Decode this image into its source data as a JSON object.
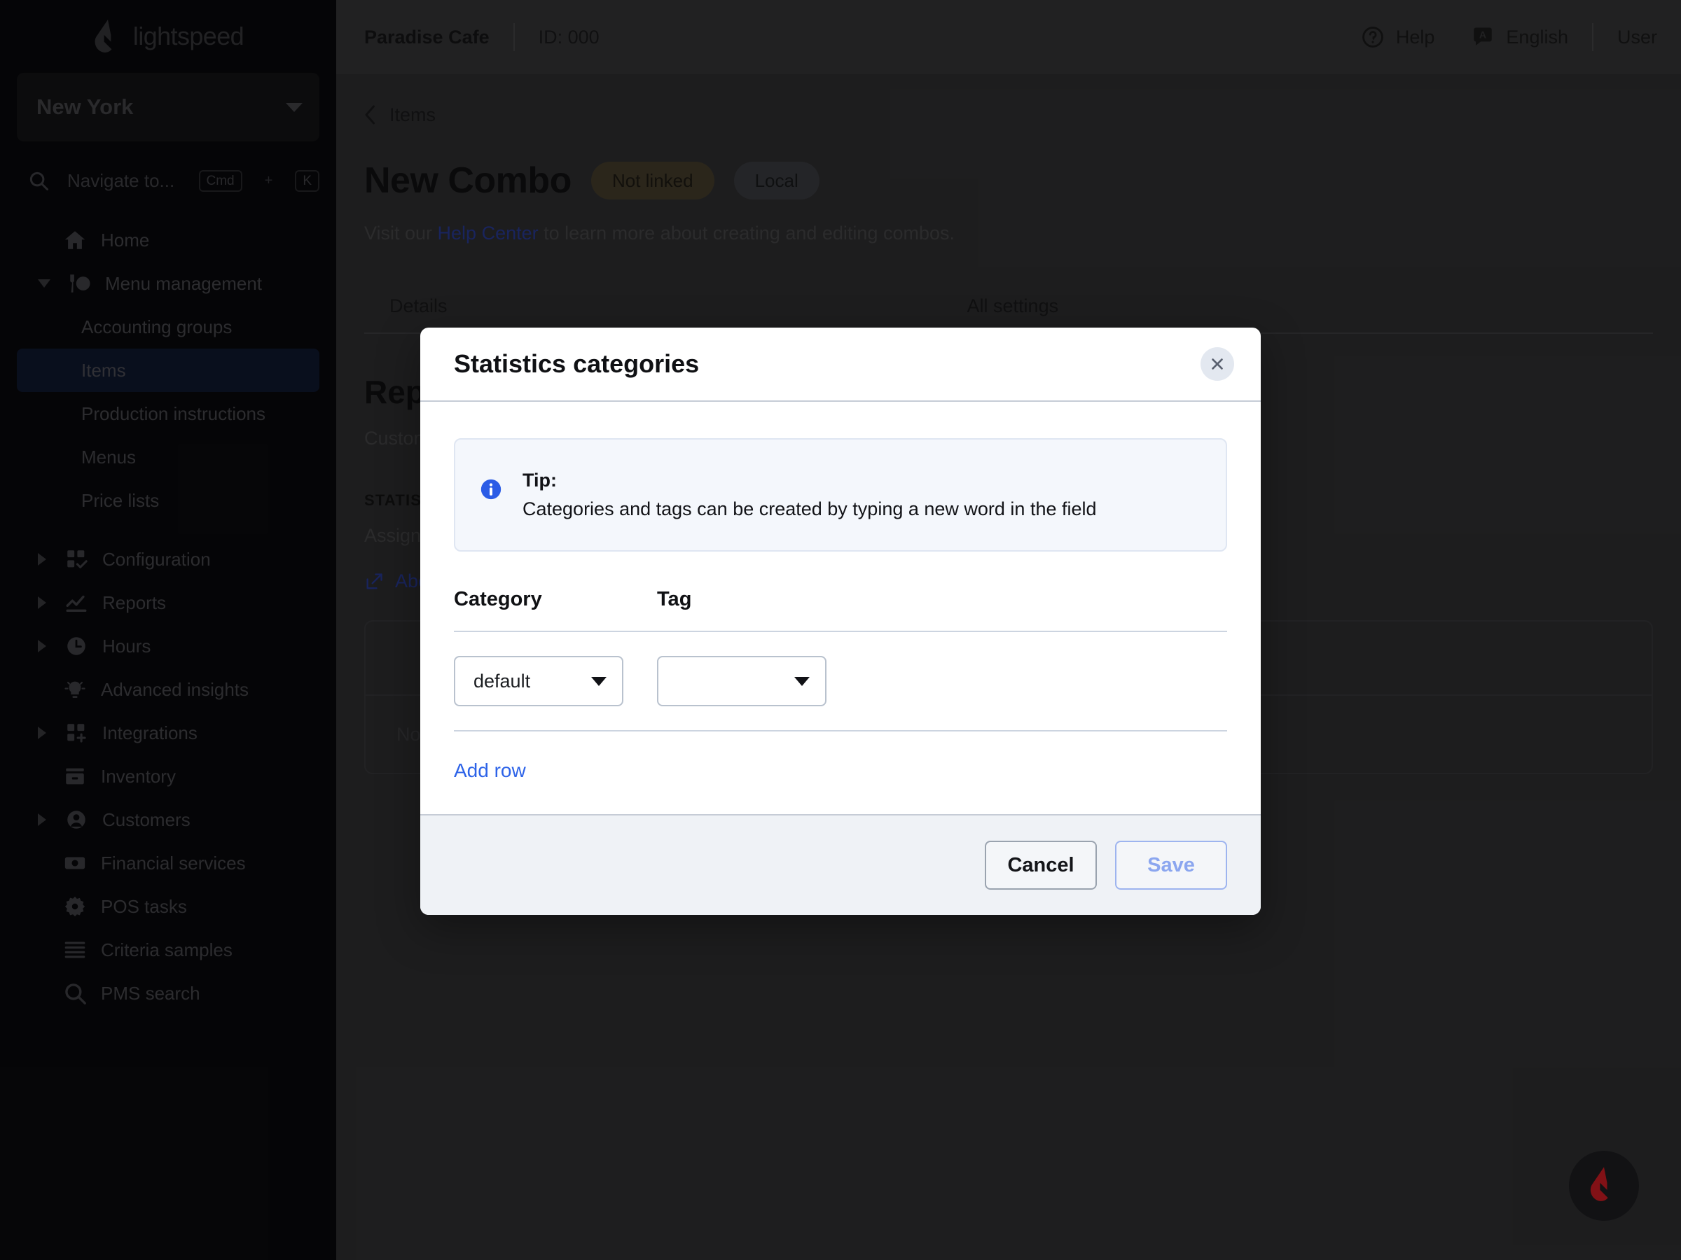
{
  "sidebar": {
    "brand": {
      "name": "lightspeed",
      "logo_icon": "lightspeed-flame-icon"
    },
    "location": {
      "value": "New York",
      "caret_icon": "chevron-down-icon"
    },
    "search": {
      "placeholder": "Navigate to...",
      "icon": "search-icon",
      "shortcut_key": "Cmd",
      "shortcut_plus": "+",
      "shortcut_key2": "K"
    },
    "items": [
      {
        "label": "Home",
        "icon": "home-icon",
        "expandable": false
      },
      {
        "label": "Menu management",
        "icon": "menu-management-icon",
        "expandable": true,
        "expanded": true
      }
    ],
    "menu_children": [
      {
        "label": "Accounting groups",
        "active": false
      },
      {
        "label": "Items",
        "active": true
      },
      {
        "label": "Production instructions",
        "active": false
      },
      {
        "label": "Menus",
        "active": false
      },
      {
        "label": "Price lists",
        "active": false
      }
    ],
    "items2": [
      {
        "label": "Configuration",
        "icon": "grid-check-icon",
        "expandable": true
      },
      {
        "label": "Reports",
        "icon": "chart-line-icon",
        "expandable": true
      },
      {
        "label": "Hours",
        "icon": "clock-icon",
        "expandable": true
      },
      {
        "label": "Advanced insights",
        "icon": "lightbulb-icon",
        "expandable": false
      },
      {
        "label": "Integrations",
        "icon": "grid-plus-icon",
        "expandable": true
      },
      {
        "label": "Inventory",
        "icon": "inventory-box-icon",
        "expandable": false
      },
      {
        "label": "Customers",
        "icon": "user-circle-icon",
        "expandable": true
      },
      {
        "label": "Financial services",
        "icon": "banknote-icon",
        "expandable": false
      },
      {
        "label": "POS tasks",
        "icon": "gear-icon",
        "expandable": false
      },
      {
        "label": "Criteria samples",
        "icon": "list-lines-icon",
        "expandable": false
      },
      {
        "label": "PMS search",
        "icon": "search-icon",
        "expandable": false
      }
    ]
  },
  "topbar": {
    "venue": "Paradise Cafe",
    "id": "ID: 000",
    "help": "Help",
    "help_icon": "question-circle-icon",
    "language": "English",
    "language_icon": "translate-icon",
    "user": "User"
  },
  "page": {
    "breadcrumb": "Items",
    "breadcrumb_icon": "chevron-left-icon",
    "title": "New Combo",
    "badges": [
      {
        "label": "Not linked",
        "style": "warn"
      },
      {
        "label": "Local",
        "style": "neutral"
      }
    ],
    "subtitle_before": "Visit our ",
    "subtitle_link": "Help Center",
    "subtitle_after": " to learn more about creating and editing combos.",
    "tabs": [
      {
        "label": "Details",
        "active": true
      },
      {
        "label": "All settings",
        "active": false
      }
    ],
    "section": {
      "title": "Reporting",
      "description": "Customize how this combo is tracked in your reports and accounting.",
      "eyebrow": "STATISTICS CATEGORIES",
      "sub": "Assign statistics categories and tags to organize this combo in reports.",
      "link": "About statistics categories",
      "link_icon": "external-link-icon",
      "empty": "No statistics categories have been added yet."
    }
  },
  "fab": {
    "icon": "lightspeed-flame-icon"
  },
  "modal": {
    "title": "Statistics categories",
    "close_icon": "close-icon",
    "tip": {
      "icon": "info-icon",
      "label": "Tip:",
      "text": "Categories and tags can be created by typing a new word in the field"
    },
    "table": {
      "columns": [
        "Category",
        "Tag"
      ],
      "rows": [
        {
          "category": "default",
          "tag": ""
        }
      ],
      "caret_icon": "chevron-down-icon"
    },
    "add_row": "Add row",
    "cancel": "Cancel",
    "save": "Save"
  },
  "colors": {
    "sidebar_bg": "#0a0a0d",
    "main_bg": "#333335",
    "accent_link": "#2d63e8",
    "save_disabled": "#8ba6ef",
    "flame_red": "#e01e26",
    "active_nav": "#111a33"
  }
}
